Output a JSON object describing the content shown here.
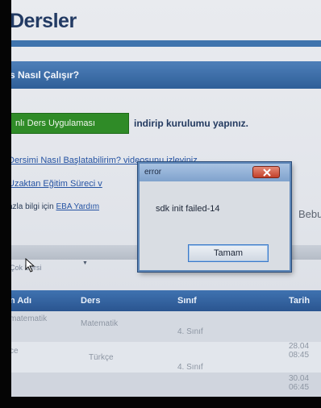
{
  "page": {
    "title": "Dersler",
    "section_title": "s Nasıl Çalışır?",
    "step_button_label": "nlı Ders Uygulaması",
    "step_text": "indirip kurulumu yapınız.",
    "link_how_to_start": "Dersimi Nasıl Başlatabilirim? videosunu izleyiniz.",
    "link_remote_process": "Uzaktan Eğitim Süreci v",
    "more_info_prefix": "azla bilgi için",
    "more_info_link": "EBA Yardım",
    "side_text": "Bebur",
    "filter_label": "Çok Dersi",
    "filter_arrow": "▼"
  },
  "table": {
    "headers": [
      "n Adı",
      "Ders",
      "Sınıf",
      "Tarih"
    ],
    "rows": [
      {
        "name": "matematik",
        "subject": "Matematik",
        "class": "4. Sınıf",
        "date": ""
      },
      {
        "name": "ce",
        "subject": "Türkçe",
        "class": "4. Sınıf",
        "date": "28.04\n08:45"
      },
      {
        "name": "",
        "subject": "",
        "class": "",
        "date": "30.04\n06:45"
      }
    ]
  },
  "dialog": {
    "title": "error",
    "message": "sdk init failed-14",
    "ok_label": "Tamam"
  },
  "colors": {
    "accent_blue": "#3f74ad",
    "green_button": "#2f8b27",
    "dialog_border": "#5e87b8",
    "close_red": "#c2402a"
  },
  "icons": [
    "close-icon",
    "cursor-icon",
    "chevron-down-icon"
  ]
}
